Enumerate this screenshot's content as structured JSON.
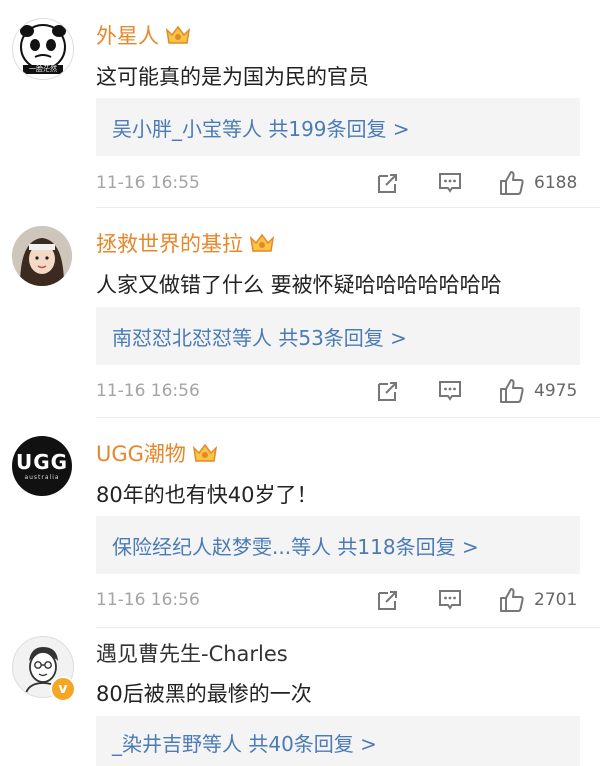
{
  "comments": [
    {
      "username": "外星人",
      "badge": "crown-vip-icon",
      "text": "这可能真的是为国为民的官员",
      "reply_summary": "吴小胖_小宝等人  共199条回复 >",
      "time": "11-16 16:55",
      "likes": "6188",
      "avatar_caption": "一脸茫然"
    },
    {
      "username": "拯救世界的基拉",
      "badge": "crown-vip-icon",
      "text": "人家又做错了什么 要被怀疑哈哈哈哈哈哈哈",
      "reply_summary": "南怼怼北怼怼等人  共53条回复 >",
      "time": "11-16 16:56",
      "likes": "4975"
    },
    {
      "username": "UGG潮物",
      "badge": "crown-vip-icon",
      "text": "80年的也有快40岁了！",
      "reply_summary": "保险经纪人赵梦雯...等人  共118条回复 >",
      "time": "11-16 16:56",
      "likes": "2701",
      "avatar_logo": "UGG",
      "avatar_sub": "australia"
    },
    {
      "username": "遇见曹先生-Charles",
      "badge": "verified-v-badge",
      "text": "80后被黑的最惨的一次",
      "reply_summary": "_染井吉野等人  共40条回复 >"
    }
  ],
  "icons": {
    "share": "share-icon",
    "comment": "comment-icon",
    "like": "thumbs-up-icon"
  },
  "colors": {
    "username": "#e8862a",
    "link": "#4a7bb7",
    "meta": "#a4a4a4",
    "reply_bg": "#f4f4f4"
  }
}
